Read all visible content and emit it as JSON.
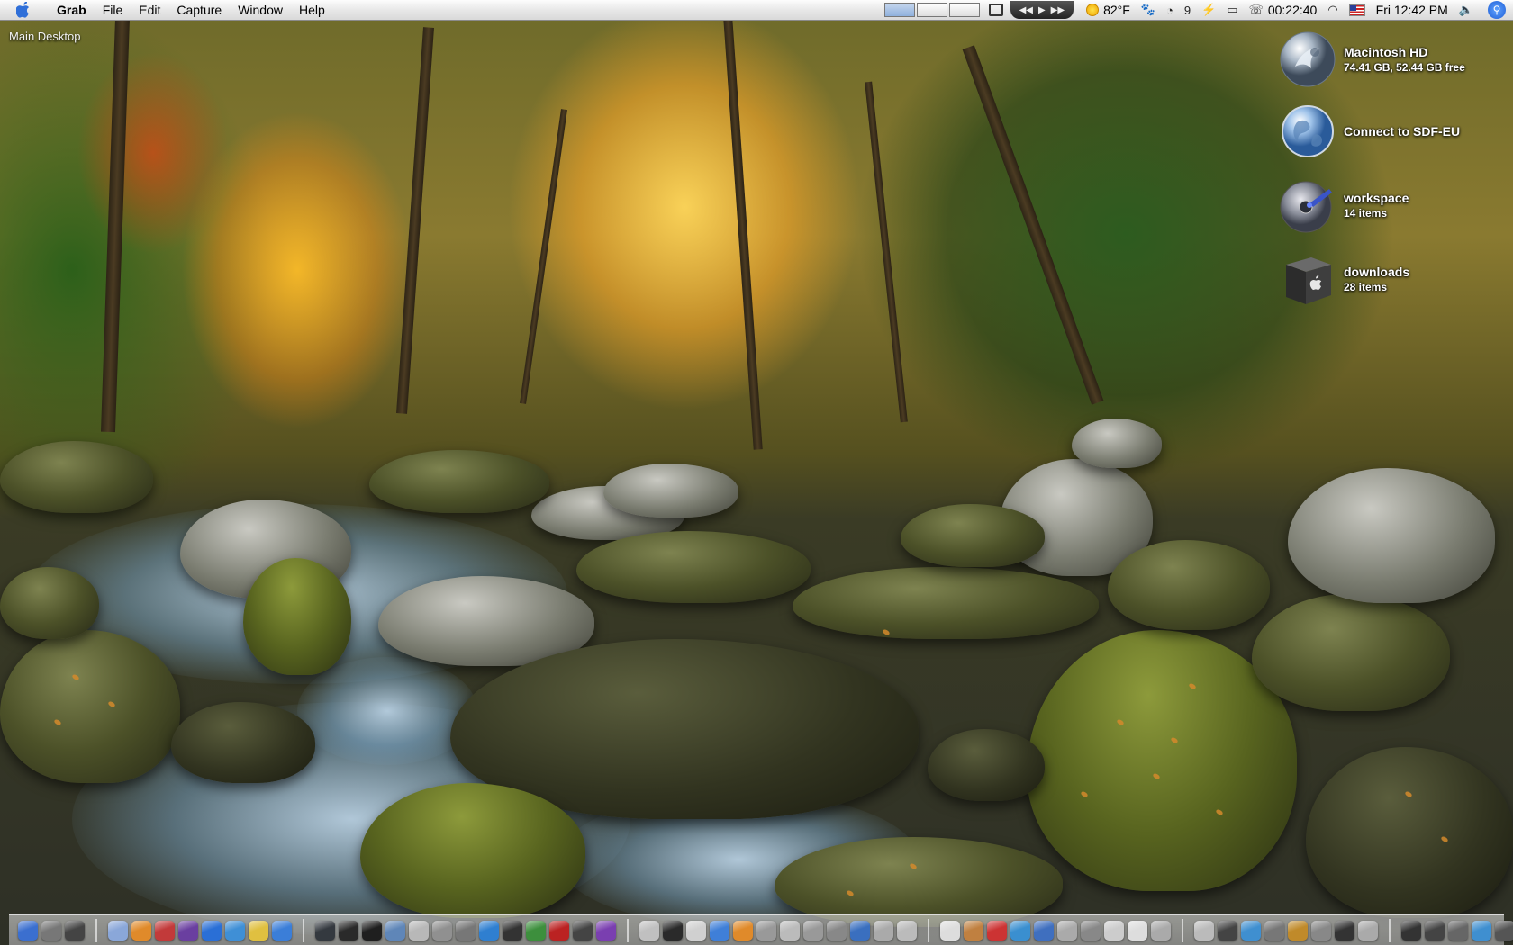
{
  "menubar": {
    "apple_icon": "apple-icon",
    "app_name": "Grab",
    "menus": [
      "File",
      "Edit",
      "Capture",
      "Window",
      "Help"
    ],
    "status": {
      "temperature": "82°F",
      "uptime": "00:22:40",
      "clock": "Fri 12:42 PM",
      "battery_glyph": "9"
    }
  },
  "desktop": {
    "label": "Main Desktop",
    "icons": [
      {
        "name": "Macintosh HD",
        "detail": "74.41 GB, 52.44 GB free",
        "icon": "hard-drive-icon"
      },
      {
        "name": "Connect to SDF-EU",
        "detail": "",
        "icon": "globe-icon"
      },
      {
        "name": "workspace",
        "detail": "14 items",
        "icon": "disc-icon"
      },
      {
        "name": "downloads",
        "detail": "28 items",
        "icon": "box-icon"
      }
    ]
  },
  "dock": {
    "colors": [
      "#3b6fcf",
      "#777777",
      "#444444",
      "#8aa7d9",
      "#e08a2a",
      "#c23a3a",
      "#6a3fa0",
      "#2a6fd6",
      "#3f8fd6",
      "#e0c040",
      "#3b7ed8",
      "#34393f",
      "#2a2a2a",
      "#1f1f1f",
      "#5f86b8",
      "#b8b8b8",
      "#909090",
      "#777777",
      "#2f7fd0",
      "#333333",
      "#3d8f3d",
      "#bb2222",
      "#444444",
      "#7a3fb0",
      "#c0c0c0",
      "#2a2a2a",
      "#d0d0d0",
      "#3f7fd8",
      "#e08a2a",
      "#999999",
      "#bbbbbb",
      "#999999",
      "#888888",
      "#3a6fbf",
      "#aaaaaa",
      "#bbbbbb",
      "#dddddd",
      "#c08040",
      "#cc3333",
      "#3a8fd0",
      "#3f6fbf",
      "#aaaaaa",
      "#888888",
      "#cccccc",
      "#dddddd",
      "#aaaaaa",
      "#bbbbbb",
      "#444444",
      "#3f8fd0",
      "#777777",
      "#c08a2a",
      "#888888",
      "#333333",
      "#aaaaaa",
      "#333333",
      "#444444",
      "#666666",
      "#3f8fd0",
      "#555555",
      "#cccccc"
    ]
  }
}
